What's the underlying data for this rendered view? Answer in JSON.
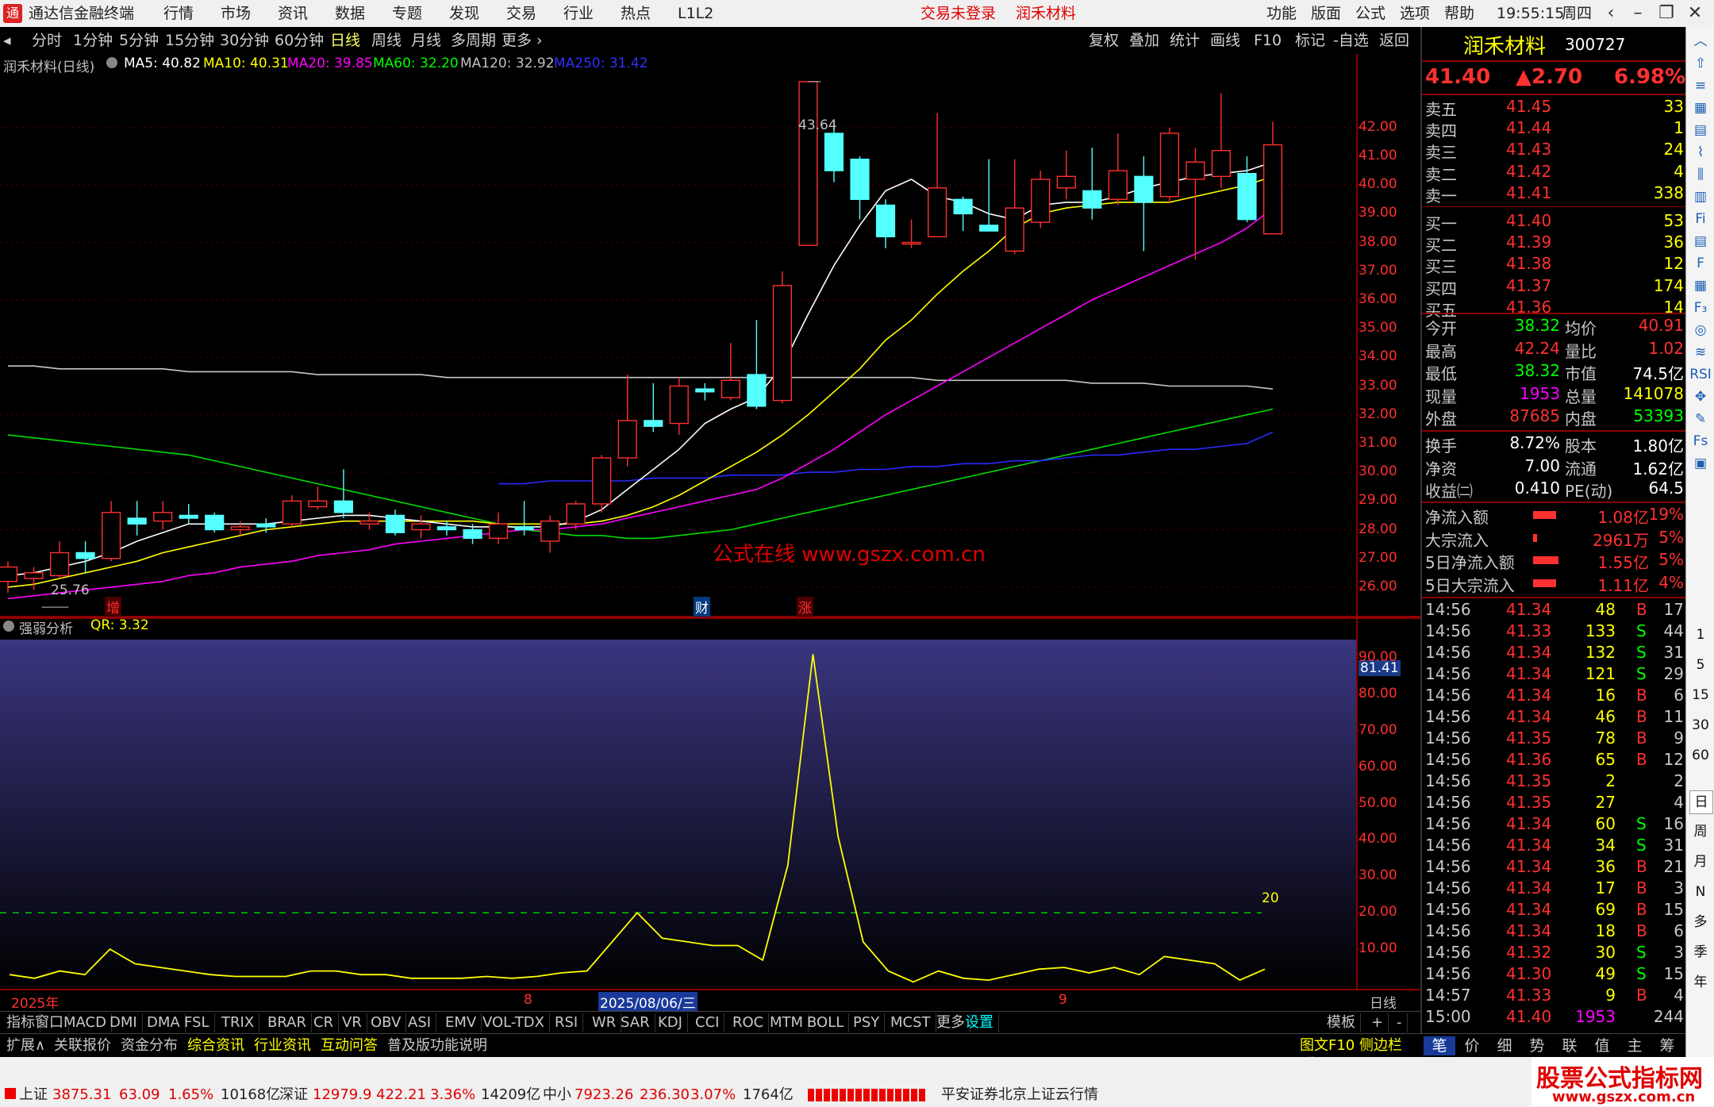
{
  "topbar": {
    "app_icon": "tdx-logo-icon",
    "app_title": "通达信金融终端",
    "menu": [
      "行情",
      "市场",
      "资讯",
      "数据",
      "专题",
      "发现",
      "交易",
      "行业",
      "热点",
      "L1L2"
    ],
    "login_status": "交易未登录",
    "stock_title": "润禾材料",
    "right_menu": [
      "功能",
      "版面",
      "公式",
      "选项",
      "帮助"
    ],
    "clock": "19:55:15",
    "weekday": "周四"
  },
  "toolbar": {
    "periods": [
      "分时",
      "1分钟",
      "5分钟",
      "15分钟",
      "30分钟",
      "60分钟",
      "日线",
      "周线",
      "月线",
      "多周期",
      "更多"
    ],
    "active_period": "日线",
    "right_buttons": [
      "复权",
      "叠加",
      "统计",
      "画线",
      "F10",
      "标记",
      "-自选",
      "返回"
    ]
  },
  "main_chart": {
    "title": "润禾材料(日线)",
    "ma_labels": [
      {
        "text": "MA5: 40.82",
        "color": "#ffffff"
      },
      {
        "text": "MA10: 40.31",
        "color": "#ffff00"
      },
      {
        "text": "MA20: 39.85",
        "color": "#ff00ff"
      },
      {
        "text": "MA60: 32.20",
        "color": "#00ff00"
      },
      {
        "text": "MA120: 32.92",
        "color": "#c0c0c0"
      },
      {
        "text": "MA250: 31.42",
        "color": "#3030ff"
      }
    ],
    "y_axis": [
      "42.00",
      "41.00",
      "40.00",
      "39.00",
      "38.00",
      "37.00",
      "36.00",
      "35.00",
      "34.00",
      "33.00",
      "32.00",
      "31.00",
      "30.00",
      "29.00",
      "28.00",
      "27.00",
      "26.00"
    ],
    "high_marker": "43.64",
    "low_marker": "25.76",
    "watermark": "公式在线  www.gszx.com.cn",
    "event_marks": [
      "增",
      "财",
      "涨"
    ]
  },
  "chart_data": {
    "type": "candlestick",
    "title": "润禾材料(日线)",
    "ylim": [
      25.5,
      43.9
    ],
    "candles": [
      {
        "o": 26.2,
        "c": 26.7,
        "h": 26.9,
        "l": 25.8
      },
      {
        "o": 26.3,
        "c": 26.5,
        "h": 26.7,
        "l": 25.9
      },
      {
        "o": 26.4,
        "c": 27.2,
        "h": 27.6,
        "l": 26.3
      },
      {
        "o": 27.2,
        "c": 27.0,
        "h": 27.6,
        "l": 26.5
      },
      {
        "o": 27.0,
        "c": 28.6,
        "h": 29.0,
        "l": 26.9
      },
      {
        "o": 28.4,
        "c": 28.2,
        "h": 29.0,
        "l": 27.8
      },
      {
        "o": 28.3,
        "c": 28.6,
        "h": 29.0,
        "l": 28.0
      },
      {
        "o": 28.5,
        "c": 28.4,
        "h": 28.9,
        "l": 28.2
      },
      {
        "o": 28.5,
        "c": 28.0,
        "h": 28.6,
        "l": 27.9
      },
      {
        "o": 28.0,
        "c": 28.1,
        "h": 28.3,
        "l": 27.8
      },
      {
        "o": 28.2,
        "c": 28.1,
        "h": 28.4,
        "l": 27.9
      },
      {
        "o": 28.2,
        "c": 29.0,
        "h": 29.2,
        "l": 28.1
      },
      {
        "o": 28.8,
        "c": 29.0,
        "h": 29.5,
        "l": 28.7
      },
      {
        "o": 29.0,
        "c": 28.6,
        "h": 30.1,
        "l": 28.4
      },
      {
        "o": 28.2,
        "c": 28.3,
        "h": 28.6,
        "l": 28.0
      },
      {
        "o": 28.5,
        "c": 27.9,
        "h": 28.7,
        "l": 27.8
      },
      {
        "o": 28.0,
        "c": 28.2,
        "h": 28.5,
        "l": 27.7
      },
      {
        "o": 28.1,
        "c": 28.0,
        "h": 28.3,
        "l": 27.8
      },
      {
        "o": 28.0,
        "c": 27.7,
        "h": 28.2,
        "l": 27.5
      },
      {
        "o": 27.7,
        "c": 28.2,
        "h": 28.6,
        "l": 27.5
      },
      {
        "o": 28.1,
        "c": 28.0,
        "h": 29.0,
        "l": 27.8
      },
      {
        "o": 27.6,
        "c": 28.3,
        "h": 28.5,
        "l": 27.2
      },
      {
        "o": 28.2,
        "c": 28.9,
        "h": 29.0,
        "l": 28.0
      },
      {
        "o": 28.9,
        "c": 30.5,
        "h": 30.6,
        "l": 28.6
      },
      {
        "o": 30.5,
        "c": 31.8,
        "h": 33.4,
        "l": 30.2
      },
      {
        "o": 31.8,
        "c": 31.6,
        "h": 33.1,
        "l": 31.4
      },
      {
        "o": 31.7,
        "c": 33.0,
        "h": 33.3,
        "l": 31.3
      },
      {
        "o": 32.9,
        "c": 32.8,
        "h": 33.1,
        "l": 32.5
      },
      {
        "o": 32.6,
        "c": 33.2,
        "h": 34.5,
        "l": 32.5
      },
      {
        "o": 33.4,
        "c": 32.3,
        "h": 35.3,
        "l": 32.2
      },
      {
        "o": 32.5,
        "c": 36.5,
        "h": 37.0,
        "l": 32.4
      },
      {
        "o": 37.9,
        "c": 43.6,
        "h": 43.6,
        "l": 37.9
      },
      {
        "o": 41.8,
        "c": 40.5,
        "h": 42.2,
        "l": 40.1
      },
      {
        "o": 40.9,
        "c": 39.5,
        "h": 41.0,
        "l": 38.8
      },
      {
        "o": 39.3,
        "c": 38.2,
        "h": 39.5,
        "l": 37.8
      },
      {
        "o": 38.0,
        "c": 38.0,
        "h": 38.8,
        "l": 37.8
      },
      {
        "o": 38.2,
        "c": 39.9,
        "h": 42.5,
        "l": 38.2
      },
      {
        "o": 39.5,
        "c": 39.0,
        "h": 39.6,
        "l": 38.4
      },
      {
        "o": 38.6,
        "c": 38.4,
        "h": 40.9,
        "l": 38.4
      },
      {
        "o": 37.7,
        "c": 39.2,
        "h": 40.9,
        "l": 37.6
      },
      {
        "o": 38.7,
        "c": 40.2,
        "h": 40.5,
        "l": 38.5
      },
      {
        "o": 39.9,
        "c": 40.3,
        "h": 41.2,
        "l": 39.5
      },
      {
        "o": 39.8,
        "c": 39.2,
        "h": 41.3,
        "l": 38.8
      },
      {
        "o": 39.5,
        "c": 40.5,
        "h": 41.8,
        "l": 39.3
      },
      {
        "o": 40.3,
        "c": 39.4,
        "h": 41.0,
        "l": 37.7
      },
      {
        "o": 39.6,
        "c": 41.8,
        "h": 42.0,
        "l": 39.4
      },
      {
        "o": 40.2,
        "c": 40.8,
        "h": 41.3,
        "l": 37.4
      },
      {
        "o": 40.3,
        "c": 41.2,
        "h": 43.2,
        "l": 39.9
      },
      {
        "o": 40.4,
        "c": 38.8,
        "h": 41.0,
        "l": 38.7
      },
      {
        "o": 38.3,
        "c": 41.4,
        "h": 42.2,
        "l": 38.3
      }
    ],
    "ma5": [
      26.4,
      26.5,
      26.7,
      26.9,
      27.2,
      27.6,
      27.9,
      28.2,
      28.2,
      28.2,
      28.2,
      28.3,
      28.4,
      28.5,
      28.5,
      28.4,
      28.3,
      28.2,
      28.1,
      28.1,
      28.1,
      28.1,
      28.3,
      28.7,
      29.4,
      30.1,
      30.8,
      31.7,
      32.2,
      32.6,
      33.7,
      35.5,
      37.2,
      38.6,
      39.8,
      40.2,
      39.6,
      39.4,
      39.0,
      38.8,
      39.3,
      39.4,
      39.4,
      39.6,
      39.9,
      40.1,
      40.3,
      40.4,
      40.5,
      40.8
    ],
    "ma10": [
      26.0,
      26.1,
      26.3,
      26.5,
      26.7,
      26.9,
      27.2,
      27.4,
      27.6,
      27.8,
      28.0,
      28.1,
      28.2,
      28.3,
      28.3,
      28.3,
      28.3,
      28.3,
      28.3,
      28.2,
      28.2,
      28.2,
      28.2,
      28.3,
      28.5,
      28.8,
      29.2,
      29.7,
      30.2,
      30.7,
      31.3,
      32.0,
      32.8,
      33.6,
      34.6,
      35.3,
      36.2,
      37.0,
      37.7,
      38.5,
      39.0,
      39.2,
      39.3,
      39.4,
      39.4,
      39.4,
      39.6,
      39.8,
      40.0,
      40.3
    ],
    "ma20": [
      25.6,
      25.7,
      25.8,
      25.9,
      26.0,
      26.1,
      26.2,
      26.4,
      26.5,
      26.7,
      26.8,
      26.9,
      27.1,
      27.2,
      27.3,
      27.5,
      27.6,
      27.7,
      27.8,
      27.9,
      28.0,
      28.0,
      28.1,
      28.2,
      28.4,
      28.6,
      28.8,
      29.0,
      29.2,
      29.4,
      29.8,
      30.3,
      30.8,
      31.4,
      32.0,
      32.5,
      33.0,
      33.5,
      34.0,
      34.5,
      35.0,
      35.5,
      36.0,
      36.4,
      36.8,
      37.2,
      37.6,
      38.0,
      38.5,
      39.2
    ],
    "ma60": [
      31.3,
      31.2,
      31.1,
      31.0,
      30.9,
      30.8,
      30.7,
      30.6,
      30.4,
      30.2,
      30.0,
      29.8,
      29.6,
      29.4,
      29.2,
      29.0,
      28.8,
      28.6,
      28.4,
      28.2,
      28.0,
      27.9,
      27.8,
      27.8,
      27.7,
      27.7,
      27.8,
      27.9,
      28.0,
      28.2,
      28.4,
      28.6,
      28.8,
      29.0,
      29.2,
      29.4,
      29.6,
      29.8,
      30.0,
      30.2,
      30.4,
      30.6,
      30.8,
      31.0,
      31.2,
      31.4,
      31.6,
      31.8,
      32.0,
      32.2
    ],
    "ma120": [
      33.7,
      33.7,
      33.6,
      33.6,
      33.6,
      33.6,
      33.6,
      33.5,
      33.5,
      33.5,
      33.5,
      33.5,
      33.4,
      33.4,
      33.4,
      33.4,
      33.4,
      33.3,
      33.3,
      33.3,
      33.3,
      33.3,
      33.3,
      33.3,
      33.3,
      33.3,
      33.3,
      33.3,
      33.3,
      33.3,
      33.3,
      33.3,
      33.3,
      33.3,
      33.3,
      33.3,
      33.2,
      33.2,
      33.2,
      33.2,
      33.2,
      33.2,
      33.1,
      33.1,
      33.1,
      33.0,
      33.0,
      33.0,
      33.0,
      32.9
    ],
    "ma250_start_index": 19,
    "ma250": [
      29.6,
      29.6,
      29.7,
      29.7,
      29.7,
      29.7,
      29.8,
      29.8,
      29.8,
      29.9,
      29.9,
      29.9,
      30.0,
      30.0,
      30.1,
      30.1,
      30.2,
      30.2,
      30.3,
      30.3,
      30.4,
      30.4,
      30.5,
      30.6,
      30.6,
      30.7,
      30.8,
      30.8,
      30.9,
      31.0,
      31.4
    ],
    "qr": [
      3,
      2,
      4,
      3,
      10,
      6,
      5,
      4,
      3,
      2.5,
      2.5,
      2.5,
      4,
      4,
      3,
      3,
      2,
      2,
      2,
      2.5,
      2,
      2.5,
      3.5,
      4,
      12,
      20,
      13,
      12,
      11,
      11,
      7,
      33,
      91,
      41,
      12,
      4,
      1,
      4,
      2,
      1.5,
      3,
      4.5,
      5,
      3.5,
      5,
      3,
      8,
      7,
      6,
      1.5,
      4.5
    ],
    "qr_ylim": [
      0,
      95
    ],
    "qr_ref": 20
  },
  "sub_chart": {
    "title": "强弱分析",
    "qr_label": "QR: 3.32",
    "y_axis": [
      "90.00",
      "80.00",
      "70.00",
      "60.00",
      "50.00",
      "40.00",
      "30.00",
      "20.00",
      "10.00"
    ],
    "current_value": "81.41",
    "ref_label": "20",
    "x_labels": [
      "2025年",
      "8",
      "2025/08/06/三",
      "9"
    ],
    "period_label": "日线"
  },
  "indicator_bar": [
    "指标",
    "窗口",
    "MACD",
    "DMI",
    "DMA",
    "FSL",
    "TRIX",
    "BRAR",
    "CR",
    "VR",
    "OBV",
    "ASI",
    "EMV",
    "VOL-TDX",
    "RSI",
    "WR",
    "SAR",
    "KDJ",
    "CCI",
    "ROC",
    "MTM",
    "BOLL",
    "PSY",
    "MCST",
    "更多",
    "设置"
  ],
  "indicator_bar_right": [
    "模板",
    "+",
    "-"
  ],
  "ext_bar": [
    "扩展∧",
    "关联报价",
    "资金分布",
    "综合资讯",
    "行业资讯",
    "互动问答",
    "普及版功能说明"
  ],
  "ext_bar_right": "图文F10 侧边栏《",
  "right_panel": {
    "name": "润禾材料",
    "code": "300727",
    "price": "41.40",
    "change": "▲2.70",
    "pct": "6.98%",
    "asks": [
      {
        "label": "卖五",
        "price": "41.45",
        "vol": "33"
      },
      {
        "label": "卖四",
        "price": "41.44",
        "vol": "1"
      },
      {
        "label": "卖三",
        "price": "41.43",
        "vol": "24"
      },
      {
        "label": "卖二",
        "price": "41.42",
        "vol": "4"
      },
      {
        "label": "卖一",
        "price": "41.41",
        "vol": "338"
      }
    ],
    "bids": [
      {
        "label": "买一",
        "price": "41.40",
        "vol": "53"
      },
      {
        "label": "买二",
        "price": "41.39",
        "vol": "36"
      },
      {
        "label": "买三",
        "price": "41.38",
        "vol": "12"
      },
      {
        "label": "买四",
        "price": "41.37",
        "vol": "174"
      },
      {
        "label": "买五",
        "price": "41.36",
        "vol": "14"
      }
    ],
    "stats": [
      {
        "l1": "今开",
        "v1": "38.32",
        "c1": "#00ff00",
        "l2": "均价",
        "v2": "40.91",
        "c2": "#ff3030"
      },
      {
        "l1": "最高",
        "v1": "42.24",
        "c1": "#ff3030",
        "l2": "量比",
        "v2": "1.02",
        "c2": "#ff3030"
      },
      {
        "l1": "最低",
        "v1": "38.32",
        "c1": "#00ff00",
        "l2": "市值",
        "v2": "74.5亿",
        "c2": "#ffffff"
      },
      {
        "l1": "现量",
        "v1": "1953",
        "c1": "#ff00ff",
        "l2": "总量",
        "v2": "141078",
        "c2": "#ffff00"
      },
      {
        "l1": "外盘",
        "v1": "87685",
        "c1": "#ff3030",
        "l2": "内盘",
        "v2": "53393",
        "c2": "#00ff00"
      }
    ],
    "stats2": [
      {
        "l1": "换手",
        "v1": "8.72%",
        "c1": "#ffffff",
        "l2": "股本",
        "v2": "1.80亿",
        "c2": "#ffffff"
      },
      {
        "l1": "净资",
        "v1": "7.00",
        "c1": "#ffffff",
        "l2": "流通",
        "v2": "1.62亿",
        "c2": "#ffffff"
      },
      {
        "l1": "收益㈡",
        "v1": "0.410",
        "c1": "#ffffff",
        "l2": "PE(动)",
        "v2": "64.5",
        "c2": "#ffffff"
      }
    ],
    "flows": [
      {
        "label": "净流入额",
        "value": "1.08亿",
        "pct": "19%",
        "bar": 0.8
      },
      {
        "label": "大宗流入",
        "value": "2961万",
        "pct": "5%",
        "bar": 0.15
      },
      {
        "label": "5日净流入额",
        "value": "1.55亿",
        "pct": "5%",
        "bar": 0.9
      },
      {
        "label": "5日大宗流入",
        "value": "1.11亿",
        "pct": "4%",
        "bar": 0.8
      }
    ],
    "ticks": [
      {
        "t": "14:56",
        "p": "41.34",
        "v": "48",
        "d": "B",
        "n": "17"
      },
      {
        "t": "14:56",
        "p": "41.33",
        "v": "133",
        "d": "S",
        "n": "44"
      },
      {
        "t": "14:56",
        "p": "41.34",
        "v": "132",
        "d": "S",
        "n": "31"
      },
      {
        "t": "14:56",
        "p": "41.34",
        "v": "121",
        "d": "S",
        "n": "29"
      },
      {
        "t": "14:56",
        "p": "41.34",
        "v": "16",
        "d": "B",
        "n": "6"
      },
      {
        "t": "14:56",
        "p": "41.34",
        "v": "46",
        "d": "B",
        "n": "11"
      },
      {
        "t": "14:56",
        "p": "41.35",
        "v": "78",
        "d": "B",
        "n": "9"
      },
      {
        "t": "14:56",
        "p": "41.36",
        "v": "65",
        "d": "B",
        "n": "12"
      },
      {
        "t": "14:56",
        "p": "41.35",
        "v": "2",
        "d": "",
        "n": "2"
      },
      {
        "t": "14:56",
        "p": "41.35",
        "v": "27",
        "d": "",
        "n": "4"
      },
      {
        "t": "14:56",
        "p": "41.34",
        "v": "60",
        "d": "S",
        "n": "16"
      },
      {
        "t": "14:56",
        "p": "41.34",
        "v": "34",
        "d": "S",
        "n": "31"
      },
      {
        "t": "14:56",
        "p": "41.34",
        "v": "36",
        "d": "B",
        "n": "21"
      },
      {
        "t": "14:56",
        "p": "41.34",
        "v": "17",
        "d": "B",
        "n": "3"
      },
      {
        "t": "14:56",
        "p": "41.34",
        "v": "69",
        "d": "B",
        "n": "15"
      },
      {
        "t": "14:56",
        "p": "41.34",
        "v": "18",
        "d": "B",
        "n": "6"
      },
      {
        "t": "14:56",
        "p": "41.32",
        "v": "30",
        "d": "S",
        "n": "3"
      },
      {
        "t": "14:56",
        "p": "41.30",
        "v": "49",
        "d": "S",
        "n": "15"
      },
      {
        "t": "14:57",
        "p": "41.33",
        "v": "9",
        "d": "B",
        "n": "4"
      },
      {
        "t": "15:00",
        "p": "41.40",
        "v": "1953",
        "d": "",
        "n": "244"
      }
    ],
    "tabs": [
      "笔",
      "价",
      "细",
      "势",
      "联",
      "值",
      "主",
      "筹"
    ]
  },
  "sidebar": [
    "1",
    "5",
    "15",
    "30",
    "60",
    "日",
    "周",
    "月",
    "N",
    "多",
    "季",
    "年"
  ],
  "statusbar": {
    "items": [
      {
        "name": "上证",
        "value": "3875.31",
        "chg": "63.09",
        "pct": "1.65%",
        "amt": "10168亿"
      },
      {
        "name": "深证",
        "value": "12979.9",
        "chg": "422.21",
        "pct": "3.36%",
        "amt": "14209亿"
      },
      {
        "name": "中小",
        "value": "7923.26",
        "chg": "236.30",
        "pct": "3.07%",
        "amt": "1764亿"
      }
    ],
    "broker": "平安证券北京上证云行情",
    "brand": "股票公式指标网",
    "brand_url": "www.gszx.com.cn"
  },
  "colors": {
    "up": "#ff3030",
    "down": "#00ffff",
    "accent": "#ffff00"
  }
}
